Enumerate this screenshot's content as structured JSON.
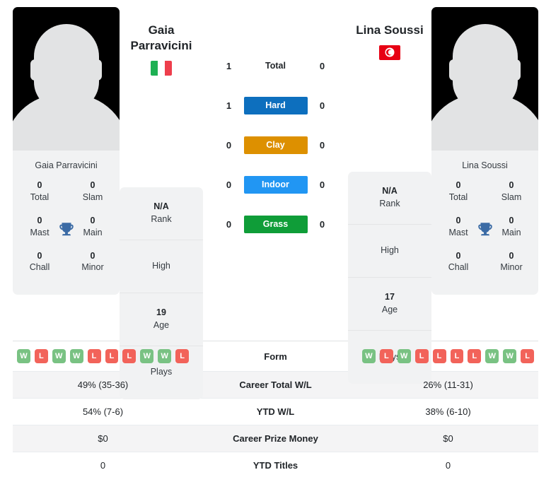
{
  "players": {
    "left": {
      "name": "Gaia Parravicini",
      "title_line1": "Gaia",
      "title_line2": "Parravicini",
      "flag": "italy-flag",
      "avatar": "player-avatar-placeholder",
      "rank": "N/A",
      "rank_label": "Rank",
      "high_label": "High",
      "high_value": "",
      "age": "19",
      "age_label": "Age",
      "plays_label": "Plays",
      "plays_value": "",
      "trophies": [
        {
          "num": "0",
          "label": "Total"
        },
        {
          "num": "0",
          "label": "Slam"
        },
        {
          "num": "0",
          "label": "Mast"
        },
        {
          "num": "0",
          "label": "Main"
        },
        {
          "num": "0",
          "label": "Chall"
        },
        {
          "num": "0",
          "label": "Minor"
        }
      ],
      "form": [
        "W",
        "L",
        "W",
        "W",
        "L",
        "L",
        "L",
        "W",
        "W",
        "L"
      ],
      "career_total_wl": "49% (35-36)",
      "ytd_wl": "54% (7-6)",
      "career_prize_money": "$0",
      "ytd_titles": "0"
    },
    "right": {
      "name": "Lina Soussi",
      "title_line1": "Lina Soussi",
      "title_line2": "",
      "flag": "tunisia-flag",
      "avatar": "player-avatar-placeholder",
      "rank": "N/A",
      "rank_label": "Rank",
      "high_label": "High",
      "high_value": "",
      "age": "17",
      "age_label": "Age",
      "plays_label": "Plays",
      "plays_value": "",
      "trophies": [
        {
          "num": "0",
          "label": "Total"
        },
        {
          "num": "0",
          "label": "Slam"
        },
        {
          "num": "0",
          "label": "Mast"
        },
        {
          "num": "0",
          "label": "Main"
        },
        {
          "num": "0",
          "label": "Chall"
        },
        {
          "num": "0",
          "label": "Minor"
        }
      ],
      "form": [
        "W",
        "L",
        "W",
        "L",
        "L",
        "L",
        "L",
        "W",
        "W",
        "L"
      ],
      "career_total_wl": "26% (11-31)",
      "ytd_wl": "38% (6-10)",
      "career_prize_money": "$0",
      "ytd_titles": "0"
    }
  },
  "head_to_head": {
    "rows": [
      {
        "left": "1",
        "label": "Total",
        "right": "0",
        "color": "none"
      },
      {
        "left": "1",
        "label": "Hard",
        "right": "0",
        "color": "#0d6fbe"
      },
      {
        "left": "0",
        "label": "Clay",
        "right": "0",
        "color": "#dd9000"
      },
      {
        "left": "0",
        "label": "Indoor",
        "right": "0",
        "color": "#2196f3"
      },
      {
        "left": "0",
        "label": "Grass",
        "right": "0",
        "color": "#0f9d38"
      }
    ]
  },
  "stats_table": {
    "rows": [
      {
        "label": "Form",
        "left": "",
        "right": "",
        "type": "form"
      },
      {
        "label": "Career Total W/L",
        "left": "49% (35-36)",
        "right": "26% (11-31)",
        "type": "text"
      },
      {
        "label": "YTD W/L",
        "left": "54% (7-6)",
        "right": "38% (6-10)",
        "type": "text"
      },
      {
        "label": "Career Prize Money",
        "left": "$0",
        "right": "$0",
        "type": "text"
      },
      {
        "label": "YTD Titles",
        "left": "0",
        "right": "0",
        "type": "text"
      }
    ]
  },
  "colors": {
    "hard": "#0d6fbe",
    "clay": "#dd9000",
    "indoor": "#2196f3",
    "grass": "#0f9d38",
    "win": "#79c283",
    "loss": "#f2635a",
    "card_bg": "#f1f2f3",
    "trophy": "#3b6ba5"
  }
}
